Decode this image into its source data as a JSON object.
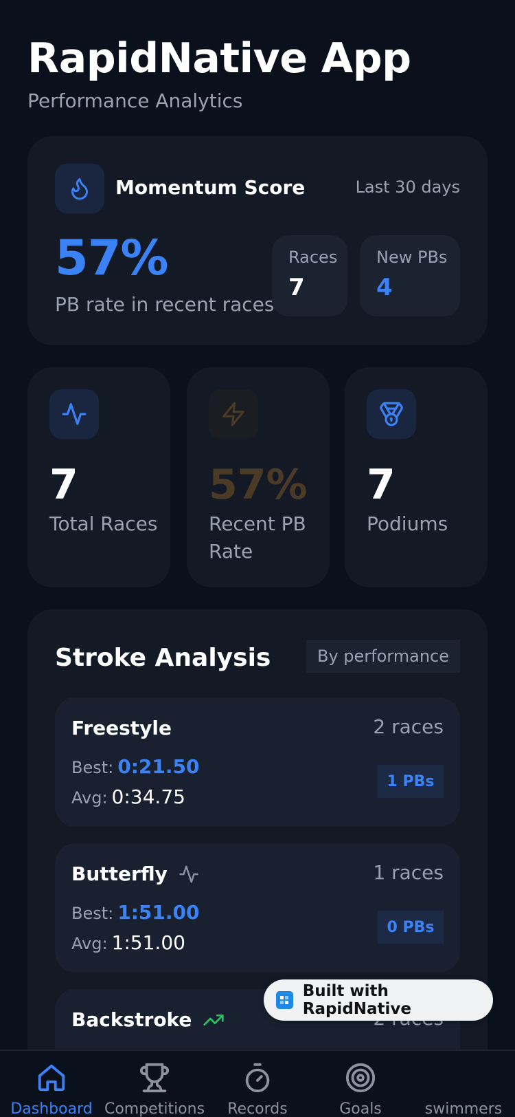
{
  "header": {
    "title": "RapidNative App",
    "subtitle": "Performance Analytics"
  },
  "momentum": {
    "title": "Momentum Score",
    "period": "Last 30 days",
    "percent": "57%",
    "description": "PB rate in recent races",
    "races_label": "Races",
    "races_value": "7",
    "pbs_label": "New PBs",
    "pbs_value": "4"
  },
  "stats": [
    {
      "value": "7",
      "label": "Total Races",
      "icon": "activity-icon",
      "color": "#ffffff"
    },
    {
      "value": "57%",
      "label": "Recent PB Rate",
      "icon": "lightning-icon",
      "color": "#4b3a26"
    },
    {
      "value": "7",
      "label": "Podiums",
      "icon": "medal-icon",
      "color": "#ffffff"
    }
  ],
  "stroke_analysis": {
    "title": "Stroke Analysis",
    "sort_label": "By performance",
    "best_label": "Best:",
    "avg_label": "Avg:",
    "rows": [
      {
        "name": "Freestyle",
        "races": "2 races",
        "best": "0:21.50",
        "avg": "0:34.75",
        "pbs": "1 PBs",
        "trend_icon": ""
      },
      {
        "name": "Butterfly",
        "races": "1 races",
        "best": "1:51.00",
        "avg": "1:51.00",
        "pbs": "0 PBs",
        "trend_icon": "activity-icon"
      },
      {
        "name": "Backstroke",
        "races": "2 races",
        "best": "",
        "avg": "",
        "pbs": "",
        "trend_icon": "trending-up-icon"
      }
    ]
  },
  "badge": {
    "label": "Built with RapidNative"
  },
  "tabs": [
    {
      "label": "Dashboard",
      "icon": "home-icon",
      "active": true
    },
    {
      "label": "Competitions",
      "icon": "trophy-icon",
      "active": false
    },
    {
      "label": "Records",
      "icon": "stopwatch-icon",
      "active": false
    },
    {
      "label": "Goals",
      "icon": "target-icon",
      "active": false
    },
    {
      "label": "swimmers",
      "icon": "users-icon",
      "active": false
    }
  ],
  "colors": {
    "accent": "#3b82f6",
    "background": "#0b111c",
    "card": "#131a26",
    "success": "#22c55e",
    "warning_muted": "#4b3a26"
  }
}
